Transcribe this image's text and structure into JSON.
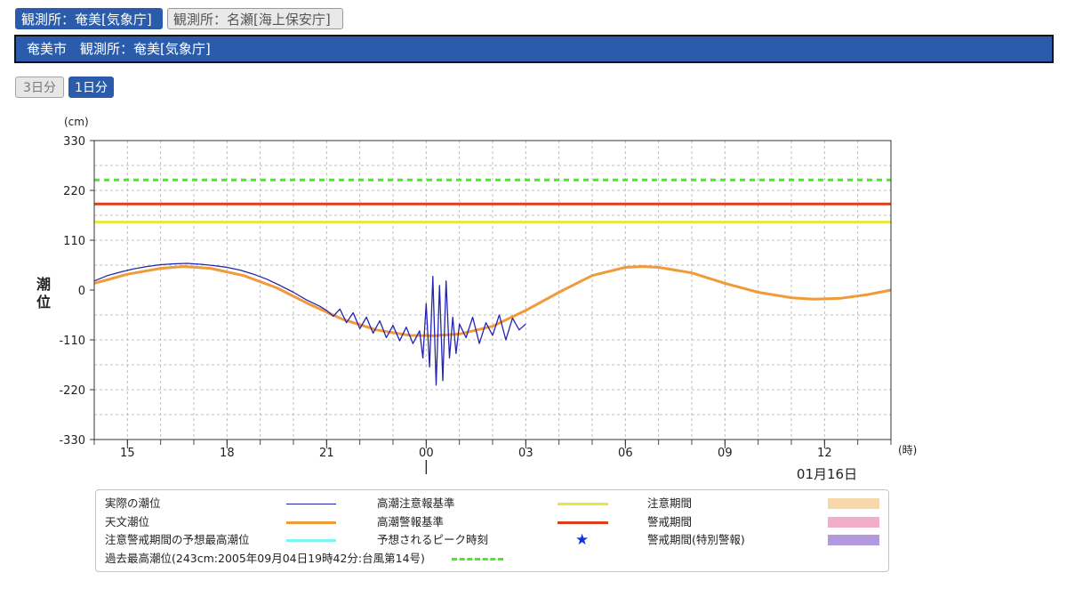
{
  "tabs": [
    {
      "label": "観測所：奄美[気象庁]",
      "active": true
    },
    {
      "label": "観測所：名瀬[海上保安庁]",
      "active": false
    }
  ],
  "header": {
    "title": "奄美市　観測所：奄美[気象庁]"
  },
  "period_buttons": [
    {
      "label": "3日分",
      "active": false
    },
    {
      "label": "1日分",
      "active": true
    }
  ],
  "chart_data": {
    "type": "line",
    "ylabel": "潮位",
    "yunit": "(cm)",
    "xunit": "(時)",
    "ylim": [
      -330,
      330
    ],
    "yticks": [
      330,
      220,
      110,
      0,
      -110,
      -220,
      -330
    ],
    "xlim": [
      14,
      38
    ],
    "xticks": [
      {
        "t": 15,
        "label": "15"
      },
      {
        "t": 18,
        "label": "18"
      },
      {
        "t": 21,
        "label": "21"
      },
      {
        "t": 24,
        "label": "00"
      },
      {
        "t": 27,
        "label": "03"
      },
      {
        "t": 30,
        "label": "06"
      },
      {
        "t": 33,
        "label": "09"
      },
      {
        "t": 36,
        "label": "12"
      }
    ],
    "date_label": "01月16日",
    "now_marker": 24,
    "grid": true,
    "thresholds": [
      {
        "name": "過去最高潮位(243cm:2005年09月04日19時42分:台風第14号)",
        "value": 243,
        "color": "#44ee22",
        "style": "dashed"
      },
      {
        "name": "高潮警報基準",
        "value": 190,
        "color": "#dd3f1d",
        "style": "solid"
      },
      {
        "name": "高潮注意報基準",
        "value": 150,
        "color": "#e8e83c",
        "style": "solid"
      }
    ],
    "series": [
      {
        "name": "天文潮位",
        "color": "#f09a3a",
        "x": [
          14,
          15,
          16,
          16.7,
          17.5,
          18.5,
          19.5,
          20.5,
          21.5,
          22.5,
          23.5,
          24.2,
          25,
          26,
          27,
          28,
          29,
          30,
          30.5,
          31,
          32,
          33,
          34,
          35,
          35.7,
          36.5,
          37.3,
          38
        ],
        "values": [
          15,
          35,
          48,
          52,
          48,
          32,
          5,
          -32,
          -65,
          -88,
          -100,
          -101,
          -97,
          -80,
          -45,
          -5,
          32,
          50,
          52,
          50,
          38,
          15,
          -5,
          -17,
          -20,
          -18,
          -10,
          0
        ]
      },
      {
        "name": "実際の潮位",
        "color": "#2424b0",
        "x": [
          14,
          14.4,
          14.8,
          15.2,
          15.6,
          16,
          16.4,
          16.8,
          17.2,
          17.6,
          18,
          18.4,
          18.8,
          19.2,
          19.6,
          20,
          20.4,
          20.8,
          21,
          21.2,
          21.4,
          21.6,
          21.8,
          22,
          22.2,
          22.4,
          22.6,
          22.8,
          23,
          23.2,
          23.4,
          23.6,
          23.8,
          23.9,
          24,
          24.1,
          24.2,
          24.3,
          24.4,
          24.5,
          24.6,
          24.7,
          24.8,
          24.9,
          25,
          25.2,
          25.4,
          25.6,
          25.8,
          26,
          26.2,
          26.4,
          26.6,
          26.8,
          27
        ],
        "values": [
          20,
          32,
          40,
          47,
          52,
          56,
          58,
          59,
          57,
          54,
          50,
          44,
          35,
          24,
          10,
          -5,
          -22,
          -36,
          -45,
          -58,
          -42,
          -72,
          -50,
          -85,
          -60,
          -95,
          -68,
          -105,
          -78,
          -112,
          -82,
          -118,
          -90,
          -150,
          -30,
          -170,
          30,
          -210,
          10,
          -200,
          20,
          -150,
          -60,
          -140,
          -75,
          -105,
          -60,
          -118,
          -72,
          -100,
          -55,
          -110,
          -62,
          -88,
          -75
        ]
      }
    ]
  },
  "legend": {
    "items": [
      {
        "label": "実際の潮位",
        "type": "line",
        "color": "#2424b0"
      },
      {
        "label": "高潮注意報基準",
        "type": "line",
        "color": "#e8e83c"
      },
      {
        "label": "注意期間",
        "type": "box",
        "color": "#f6d8ab"
      },
      {
        "label": "天文潮位",
        "type": "line",
        "color": "#f09a3a"
      },
      {
        "label": "高潮警報基準",
        "type": "line",
        "color": "#dd3f1d"
      },
      {
        "label": "警戒期間",
        "type": "box",
        "color": "#f2adc8"
      },
      {
        "label": "注意警戒期間の予想最高潮位",
        "type": "line",
        "color": "#7ff2f2"
      },
      {
        "label": "予想されるピーク時刻",
        "type": "star",
        "symbol": "★",
        "color": "#1330d6"
      },
      {
        "label": "警戒期間(特別警報)",
        "type": "box",
        "color": "#b39ae0"
      },
      {
        "label": "過去最高潮位(243cm:2005年09月04日19時42分:台風第14号)",
        "type": "dashed",
        "color": "#44ee22"
      }
    ]
  }
}
